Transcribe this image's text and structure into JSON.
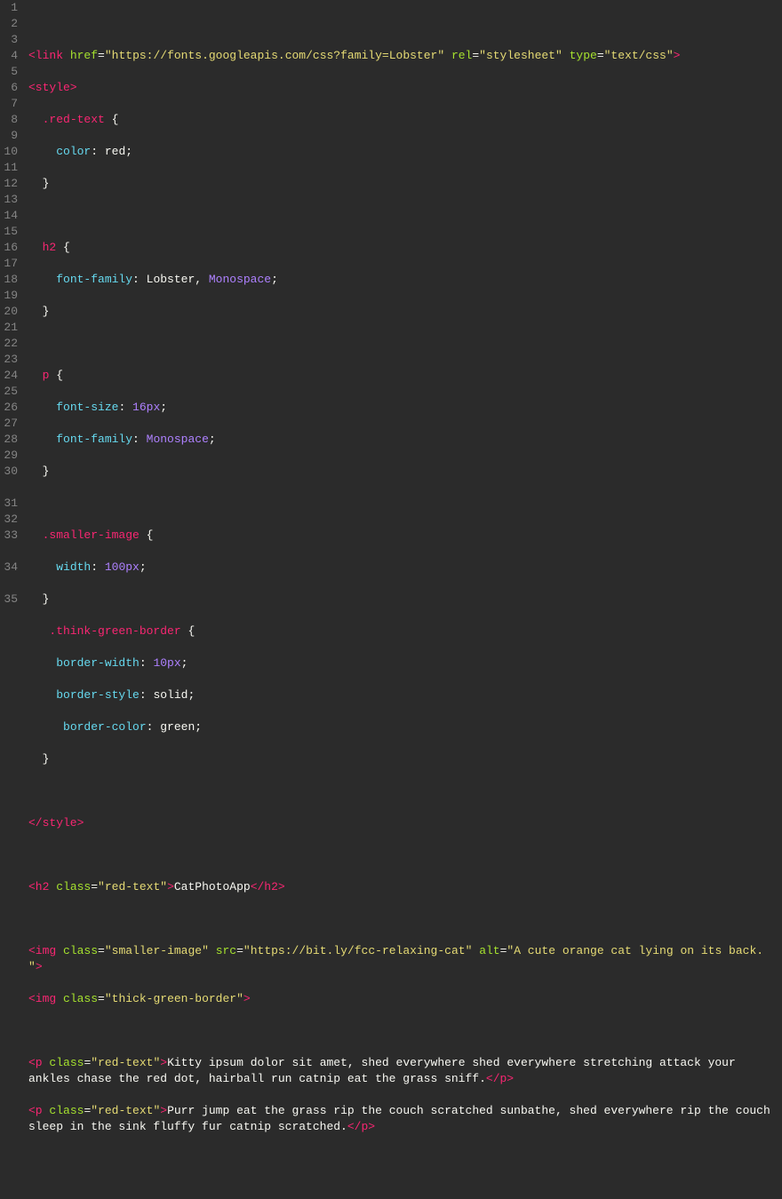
{
  "editor": {
    "lineNumbers": [
      "1",
      "2",
      "3",
      "4",
      "5",
      "6",
      "7",
      "8",
      "9",
      "10",
      "11",
      "12",
      "13",
      "14",
      "15",
      "16",
      "17",
      "18",
      "19",
      "20",
      "21",
      "22",
      "23",
      "24",
      "25",
      "26",
      "27",
      "28",
      "29",
      "30",
      "31",
      "32",
      "33",
      "34",
      "35"
    ],
    "code": {
      "line2": {
        "tagOpen": "<link",
        "attr1": "href",
        "val1": "\"https://fonts.googleapis.com/css?family=Lobster\"",
        "attr2": "rel",
        "val2": "\"stylesheet\"",
        "attr3": "type",
        "val3": "\"text/css\"",
        "close": ">"
      },
      "line3": {
        "open": "<style>",
        "sel": "",
        "close": ""
      },
      "line4": {
        "sel": ".red-text",
        "brace": " {"
      },
      "line5": {
        "prop": "color",
        "val": "red",
        "end": ";"
      },
      "line6": {
        "brace": "}"
      },
      "line8": {
        "sel": "h2",
        "brace": " {"
      },
      "line9": {
        "prop": "font-family",
        "val": "Lobster, Monospace",
        "end": ";"
      },
      "line10": {
        "brace": "}"
      },
      "line12": {
        "sel": "p",
        "brace": " {"
      },
      "line13": {
        "prop": "font-size",
        "val": "16px",
        "end": ";"
      },
      "line14": {
        "prop": "font-family",
        "val": "Monospace",
        "end": ";"
      },
      "line15": {
        "brace": "}"
      },
      "line17": {
        "sel": ".smaller-image",
        "brace": " {"
      },
      "line18": {
        "prop": "width",
        "val": "100px",
        "end": ";"
      },
      "line19": {
        "brace": "}"
      },
      "line20": {
        "sel": ".think-green-border",
        "brace": " {"
      },
      "line21": {
        "prop": "border-width",
        "val": "10px",
        "end": ";"
      },
      "line22": {
        "prop": "border-style",
        "val": "solid",
        "end": ";"
      },
      "line23": {
        "prop": "border-color",
        "val": "green",
        "end": ";"
      },
      "line24": {
        "brace": "}"
      },
      "line26": {
        "close": "</style>"
      },
      "line28": {
        "open": "<h2",
        "attr": "class",
        "val": "\"red-text\"",
        "gt": ">",
        "text": "CatPhotoApp",
        "close": "</h2>"
      },
      "line30": {
        "open": "<img",
        "attr1": "class",
        "val1": "\"smaller-image\"",
        "attr2": "src",
        "val2": "\"https://bit.ly/fcc-relaxing-cat\"",
        "attr3": "alt",
        "val3": "\"A cute orange cat lying on its back. \"",
        "close": ">"
      },
      "line31": {
        "open": "<img",
        "attr": "class",
        "val": "\"thick-green-border\"",
        "close": ">"
      },
      "line33": {
        "open": "<p",
        "attr": "class",
        "val": "\"red-text\"",
        "gt": ">",
        "text": "Kitty ipsum dolor sit amet, shed everywhere shed everywhere stretching attack your ankles chase the red dot, hairball run catnip eat the grass sniff.",
        "close": "</p>"
      },
      "line34": {
        "open": "<p",
        "attr": "class",
        "val": "\"red-text\"",
        "gt": ">",
        "text": "Purr jump eat the grass rip the couch scratched sunbathe, shed everywhere rip the couch sleep in the sink fluffy fur catnip scratched.",
        "close": "</p>"
      }
    }
  }
}
